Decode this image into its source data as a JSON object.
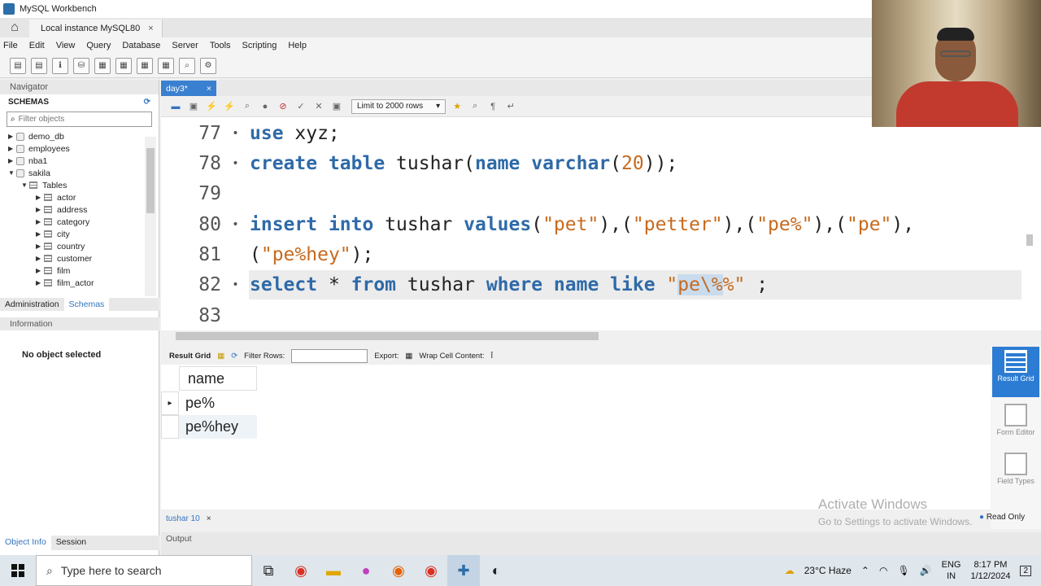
{
  "window": {
    "title": "MySQL Workbench"
  },
  "connection_tab": {
    "label": "Local instance MySQL80",
    "close": "×"
  },
  "menu": [
    "File",
    "Edit",
    "View",
    "Query",
    "Database",
    "Server",
    "Tools",
    "Scripting",
    "Help"
  ],
  "navigator": {
    "title": "Navigator",
    "schemas_label": "SCHEMAS",
    "filter_placeholder": "Filter objects",
    "schemas": [
      "demo_db",
      "employees",
      "nba1",
      "sakila"
    ],
    "tables_label": "Tables",
    "tables": [
      "actor",
      "address",
      "category",
      "city",
      "country",
      "customer",
      "film",
      "film_actor"
    ],
    "tabs": [
      "Administration",
      "Schemas"
    ],
    "info_title": "Information",
    "no_object": "No object selected",
    "bottom_tabs": [
      "Object Info",
      "Session"
    ]
  },
  "editor": {
    "tab_label": "day3*",
    "tab_close": "×",
    "limit_label": "Limit to 2000 rows",
    "lines": [
      {
        "num": "77",
        "dot": "•"
      },
      {
        "num": "78",
        "dot": "•"
      },
      {
        "num": "79",
        "dot": ""
      },
      {
        "num": "80",
        "dot": "•"
      },
      {
        "num": "81",
        "dot": ""
      },
      {
        "num": "82",
        "dot": "•"
      },
      {
        "num": "83",
        "dot": ""
      }
    ],
    "tokens": {
      "use": "use",
      "xyz": " xyz;",
      "create": "create",
      "table": "table",
      "tushar1": " tushar(",
      "name1": "name",
      "varchar": "varchar",
      "p1": "(",
      "n20": "20",
      "p2": "));",
      "insert": "insert",
      "into": "into",
      "tushar2": " tushar ",
      "values": "values",
      "v1": "(",
      "s1": "\"pet\"",
      "c1": "),(",
      "s2": "\"petter\"",
      "c2": "),(",
      "s3": "\"pe%\"",
      "c3": "),(",
      "s4": "\"pe\"",
      "c4": "),",
      "l81a": "(",
      "s5": "\"pe%hey\"",
      "l81b": ");",
      "select": "select",
      "star": " * ",
      "from": "from",
      "tushar3": " tushar ",
      "where": "where",
      "name2": "name",
      "like": "like",
      "q1": " \"",
      "hl": "pe\\%",
      "q2": "%\"",
      "semi": " ;"
    }
  },
  "result": {
    "grid_label": "Result Grid",
    "filter_label": "Filter Rows:",
    "export_label": "Export:",
    "wrap_label": "Wrap Cell Content:",
    "column": "name",
    "rows": [
      "pe%",
      "pe%hey"
    ],
    "tab_label": "tushar 10",
    "tab_close": "×",
    "read_only": "Read Only",
    "side": [
      "Result Grid",
      "Form Editor",
      "Field Types"
    ]
  },
  "output": {
    "label": "Output"
  },
  "watermark": {
    "line1": "Activate Windows",
    "line2": "Go to Settings to activate Windows."
  },
  "taskbar": {
    "search_placeholder": "Type here to search",
    "weather": "23°C  Haze",
    "lang": "ENG",
    "region": "IN",
    "time": "8:17 PM",
    "date": "1/12/2024",
    "notif_count": "2"
  }
}
